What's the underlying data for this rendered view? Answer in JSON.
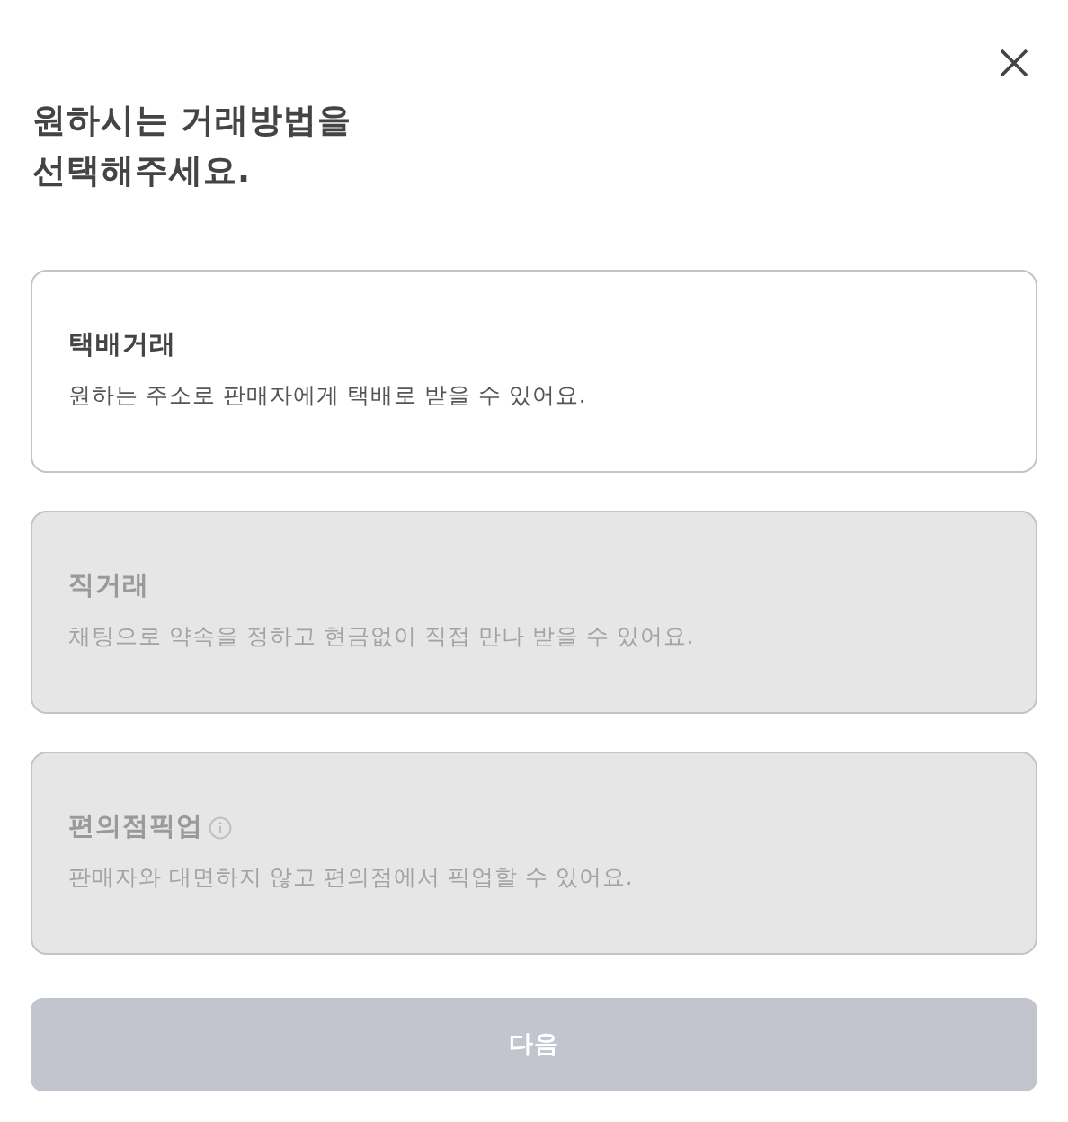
{
  "title_lines": [
    "원하시는 거래방법을",
    "선택해주세요."
  ],
  "options": [
    {
      "label": "택배거래",
      "description": "원하는 주소로 판매자에게 택배로 받을 수 있어요.",
      "disabled": false,
      "info": false
    },
    {
      "label": "직거래",
      "description": "채팅으로 약속을 정하고 현금없이 직접 만나 받을 수 있어요.",
      "disabled": true,
      "info": false
    },
    {
      "label": "편의점픽업",
      "description": "판매자와 대면하지 않고 편의점에서 픽업할 수 있어요.",
      "disabled": true,
      "info": true
    }
  ],
  "next_button": {
    "label": "다음",
    "disabled": true
  }
}
